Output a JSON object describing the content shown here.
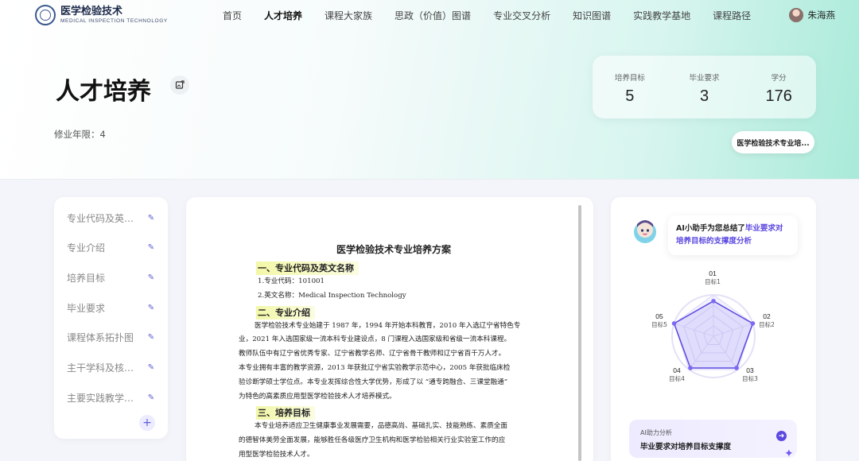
{
  "brand": {
    "name_cn": "医学检验技术",
    "name_en": "MEDICAL INSPECTION TECHNOLOGY"
  },
  "nav": {
    "items": [
      {
        "label": "首页",
        "active": false
      },
      {
        "label": "人才培养",
        "active": true
      },
      {
        "label": "课程大家族",
        "active": false
      },
      {
        "label": "思政（价值）图谱",
        "active": false
      },
      {
        "label": "专业交叉分析",
        "active": false
      },
      {
        "label": "知识图谱",
        "active": false
      },
      {
        "label": "实践教学基地",
        "active": false
      },
      {
        "label": "课程路径",
        "active": false
      }
    ]
  },
  "user": {
    "name": "朱海燕"
  },
  "hero": {
    "title": "人才培养",
    "years": "修业年限：4",
    "stats": [
      {
        "label": "培养目标",
        "value": "5"
      },
      {
        "label": "毕业要求",
        "value": "3"
      },
      {
        "label": "学分",
        "value": "176"
      }
    ],
    "doc_pill": "医学检验技术专业培..."
  },
  "toc": {
    "items": [
      {
        "label": "专业代码及英文..."
      },
      {
        "label": "专业介绍"
      },
      {
        "label": "培养目标"
      },
      {
        "label": "毕业要求"
      },
      {
        "label": "课程体系拓扑图"
      },
      {
        "label": "主干学科及核心..."
      },
      {
        "label": "主要实践教学环节"
      }
    ],
    "add": "+"
  },
  "document": {
    "title": "医学检验技术专业培养方案",
    "h1": "一、专业代码及英文名称",
    "code_line": "1.专业代码：101001",
    "en_line": "2.英文名称：Medical Inspection Technology",
    "h2": "二、专业介绍",
    "intro": [
      "医学检验技术专业始建于 1987 年，1994 年开始本科教育，2010 年入选辽宁省特色专",
      "业，2021 年入选国家级一流本科专业建设点，8 门课程入选国家级和省级一流本科课程。",
      "教师队伍中有辽宁省优秀专家、辽宁省教学名师、辽宁省骨干教师和辽宁省百千万人才。",
      "本专业拥有丰富的教学资源，2013 年获批辽宁省实验教学示范中心，2005 年获批临床检",
      "验诊断学硕士学位点。本专业发挥综合性大学优势，形成了以 “通专跨融合、三课堂融通”",
      "为特色的高素质应用型医学检验技术人才培养模式。"
    ],
    "h3": "三、培养目标",
    "goal": [
      "本专业培养适应卫生健康事业发展需要，品德高尚、基础扎实、技能熟练、素质全面",
      "的德智体美劳全面发展，能够胜任各级医疗卫生机构和医学检验相关行业实验室工作的应",
      "用型医学检验技术人才。"
    ]
  },
  "ai": {
    "bubble_prefix": "AI小助手为您总结了",
    "bubble_highlight_1": "毕业要求对",
    "bubble_highlight_2": "培养目标的支撑度分析",
    "radar": [
      {
        "num": "01",
        "name": "目标1",
        "value": 0.85
      },
      {
        "num": "02",
        "name": "目标2",
        "value": 1.0
      },
      {
        "num": "03",
        "name": "目标3",
        "value": 0.95
      },
      {
        "num": "04",
        "name": "目标4",
        "value": 0.95
      },
      {
        "num": "05",
        "name": "目标5",
        "value": 1.0
      }
    ],
    "bottom_small": "AI助力分析",
    "bottom_main": "毕业要求对培养目标支撑度",
    "accent": "#5b49e0"
  }
}
